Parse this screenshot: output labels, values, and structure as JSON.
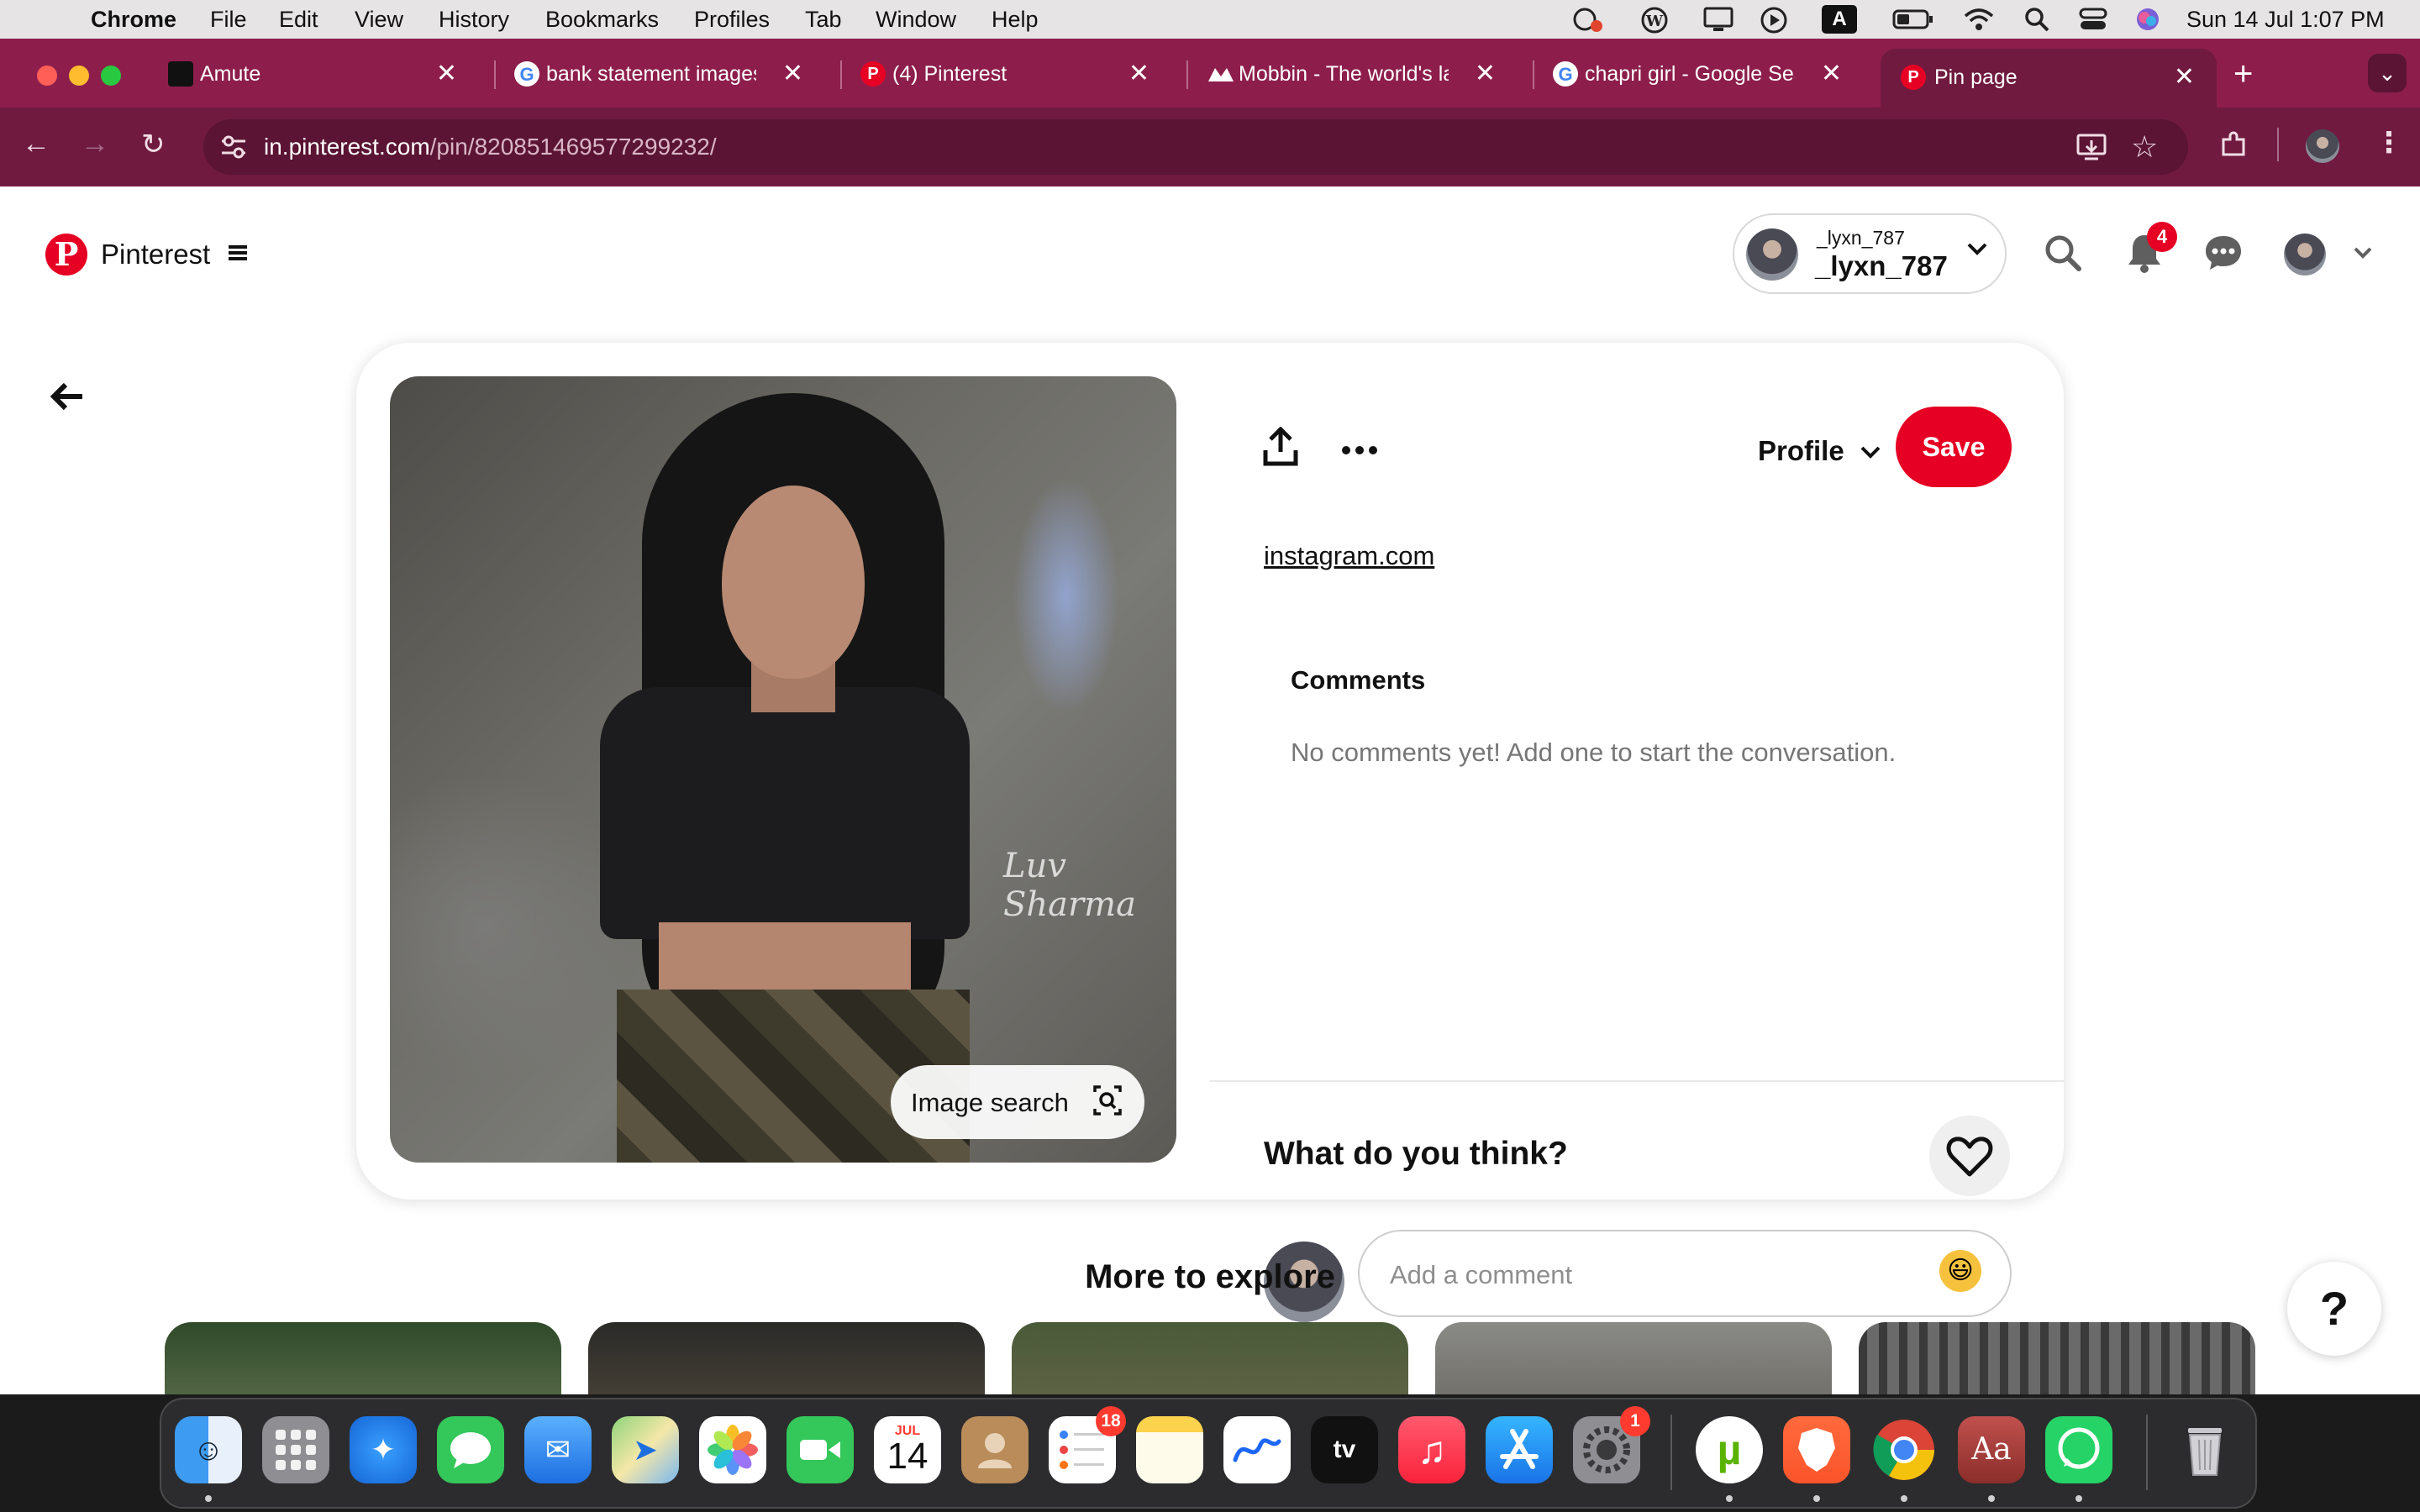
{
  "menubar": {
    "app_name": "Chrome",
    "menus": [
      "File",
      "Edit",
      "View",
      "History",
      "Bookmarks",
      "Profiles",
      "Tab",
      "Window",
      "Help"
    ],
    "input_indicator": "A",
    "datetime": "Sun 14 Jul  1:07 PM"
  },
  "browser": {
    "tabs": [
      {
        "title": "Amute"
      },
      {
        "title": "bank statement images"
      },
      {
        "title": "(4) Pinterest"
      },
      {
        "title": "Mobbin - The world's la"
      },
      {
        "title": "chapri girl - Google Sea"
      },
      {
        "title": "Pin page",
        "active": true
      }
    ],
    "new_tab_label": "+",
    "url_host": "in.pinterest.com",
    "url_path": "/pin/820851469577299232/"
  },
  "header": {
    "brand": "Pinterest",
    "account_handle_small": "_lyxn_787",
    "account_handle": "_lyxn_787",
    "notification_count": "4"
  },
  "pin": {
    "watermark": "Luv Sharma",
    "image_search_label": "Image search",
    "profile_select_label": "Profile",
    "save_label": "Save",
    "source_link": "instagram.com",
    "comments_title": "Comments",
    "no_comments_text": "No comments yet! Add one to start the conversation.",
    "what_think": "What do you think?",
    "comment_placeholder": "Add a comment",
    "emoji": "😃"
  },
  "explore": {
    "title": "More to explore",
    "help_label": "?"
  },
  "dock": {
    "calendar_month": "JUL",
    "calendar_day": "14",
    "reminders_badge": "18",
    "settings_badge": "1",
    "tv_label": "tv",
    "dictionary_label": "Aa"
  },
  "colors": {
    "chrome_tabstrip": "#8d1e4c",
    "chrome_toolbar": "#701a40",
    "pinterest_red": "#e60023"
  }
}
